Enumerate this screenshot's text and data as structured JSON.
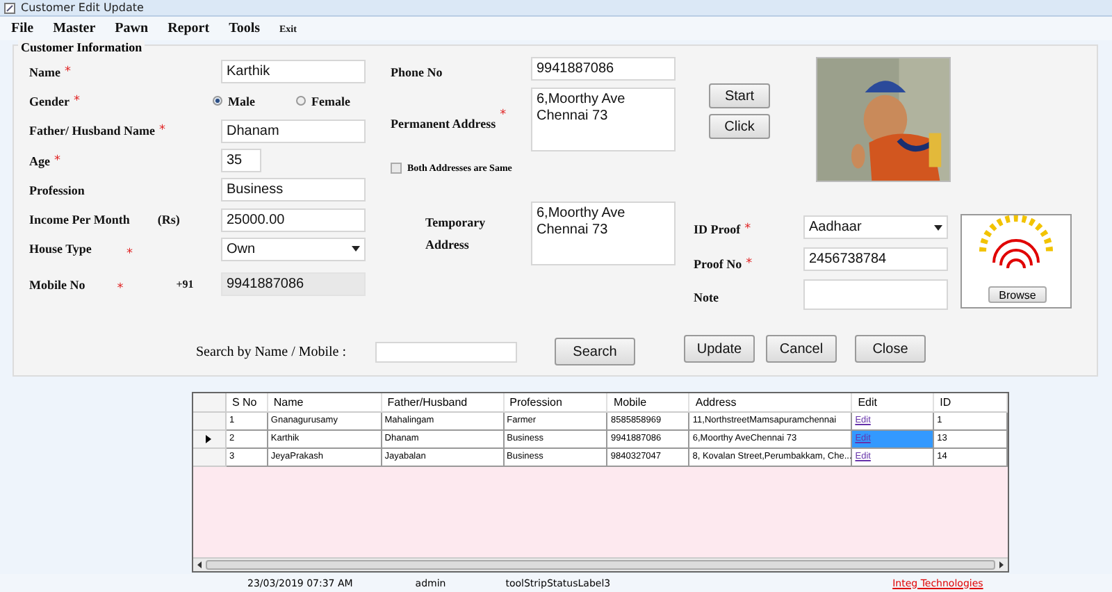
{
  "window": {
    "title": "Customer Edit Update"
  },
  "menu": [
    "File",
    "Master",
    "Pawn",
    "Report",
    "Tools",
    "Exit"
  ],
  "group_title": "Customer Information",
  "left_fields": [
    {
      "kind": "text",
      "label": "Name",
      "mark": "*",
      "value": "Karthik"
    },
    {
      "kind": "radio",
      "label": "Gender",
      "mark": "*",
      "options": [
        {
          "label": "Male",
          "selected": true
        },
        {
          "label": "Female",
          "selected": false
        }
      ]
    },
    {
      "kind": "text",
      "label": "Father/ Husband Name",
      "mark": "*",
      "value": "Dhanam"
    },
    {
      "kind": "short",
      "label": "Age",
      "mark": "*",
      "value": "35"
    },
    {
      "kind": "text",
      "label": "Profession",
      "value": "Business"
    },
    {
      "kind": "text",
      "label": "Income Per Month",
      "unit": "(Rs)",
      "value": "25000.00"
    },
    {
      "kind": "select",
      "label": "House Type",
      "mark": "*",
      "value": "Own"
    },
    {
      "kind": "readonly",
      "label": "Mobile No",
      "prefix": "+91",
      "mark": "*",
      "value": "9941887086"
    }
  ],
  "phone": {
    "label": "Phone No",
    "value": "9941887086"
  },
  "permanent_address": {
    "label": "Permanent Address",
    "mark": "*",
    "lines": [
      "6,Moorthy Ave",
      "Chennai 73"
    ]
  },
  "same_address": {
    "label": "Both Addresses are Same",
    "checked": false
  },
  "temporary_address": {
    "label_lines": [
      "Temporary",
      "Address"
    ],
    "lines": [
      "6,Moorthy Ave",
      "Chennai 73"
    ]
  },
  "camera_buttons": [
    "Start",
    "Click"
  ],
  "id_proof": {
    "label": "ID Proof",
    "mark": "*",
    "value": "Aadhaar"
  },
  "proof_no": {
    "label": "Proof No",
    "mark": "*",
    "value": "2456738784"
  },
  "note": {
    "label": "Note"
  },
  "browse_button": "Browse",
  "search": {
    "label": "Search by Name / Mobile :",
    "button": "Search"
  },
  "action_buttons": [
    "Update",
    "Cancel",
    "Close"
  ],
  "table": {
    "columns": [
      "S No",
      "Name",
      "Father/Husband",
      "Profession",
      "Mobile",
      "Address",
      "Edit",
      "ID"
    ],
    "rows": [
      {
        "cells": [
          "1",
          "Gnanagurusamy",
          "Mahalingam",
          "Farmer",
          "8585858969",
          "11,NorthstreetMamsapuramchennai",
          "Edit",
          "1"
        ],
        "selected": false
      },
      {
        "cells": [
          "2",
          "Karthik",
          "Dhanam",
          "Business",
          "9941887086",
          "6,Moorthy AveChennai 73",
          "Edit",
          "13"
        ],
        "selected": true
      },
      {
        "cells": [
          "3",
          "JeyaPrakash",
          "Jayabalan",
          "Business",
          "9840327047",
          "8, Kovalan Street,Perumbakkam, Che...",
          "Edit",
          "14"
        ],
        "selected": false
      }
    ]
  },
  "status_bar": {
    "items": [
      "23/03/2019 07:37 AM",
      "admin",
      "toolStripStatusLabel3"
    ],
    "link": "Integ Technologies"
  }
}
